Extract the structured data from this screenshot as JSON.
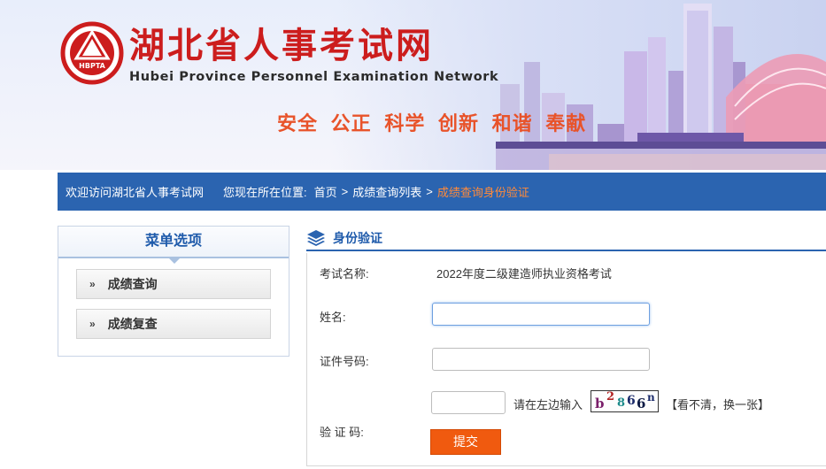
{
  "header": {
    "title": "湖北省人事考试网",
    "subtitle": "Hubei Province Personnel Examination Network",
    "logo_text": "HBPTA",
    "slogan": "安全 公正 科学 创新 和谐 奉献"
  },
  "nav": {
    "welcome": "欢迎访问湖北省人事考试网",
    "location_label": "您现在所在位置:",
    "breadcrumb": [
      "首页",
      "成绩查询列表",
      "成绩查询身份验证"
    ],
    "separator": ">"
  },
  "sidebar": {
    "heading": "菜单选项",
    "items": [
      {
        "label": "成绩查询",
        "arrow": "»"
      },
      {
        "label": "成绩复查",
        "arrow": "»"
      }
    ]
  },
  "panel": {
    "title": "身份验证",
    "exam_label": "考试名称:",
    "exam_value": "2022年度二级建造师执业资格考试",
    "name_label": "姓名:",
    "id_label": "证件号码:",
    "captcha_label": "验 证 码:",
    "captcha_hint": "请在左边输入",
    "captcha_chars": [
      "b",
      "2",
      "8",
      "6",
      "6",
      "n"
    ],
    "refresh_label": "【看不清，换一张】",
    "submit_label": "提交"
  },
  "colors": {
    "brand_red": "#cc1d1d",
    "nav_blue": "#2b64b0",
    "accent_orange": "#f05a0f",
    "breadcrumb_current": "#ff8a3a"
  }
}
